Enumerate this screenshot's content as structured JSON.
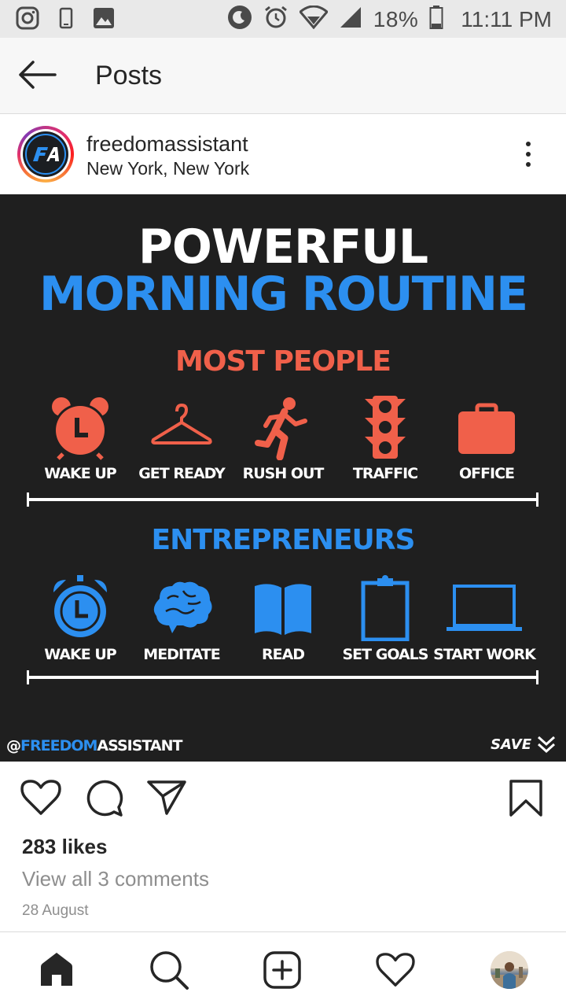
{
  "status_bar": {
    "battery": "18%",
    "time": "11:11 PM",
    "icons": [
      "instagram-icon",
      "phone-icon",
      "image-icon",
      "do-not-disturb-icon",
      "alarm-icon",
      "wifi-icon",
      "signal-icon",
      "battery-icon"
    ]
  },
  "appbar": {
    "title": "Posts"
  },
  "post": {
    "username": "freedomassistant",
    "location": "New York, New York",
    "avatar_text": "FA",
    "image": {
      "title_line1": "POWERFUL",
      "title_line2": "MORNING ROUTINE",
      "section1": "MOST PEOPLE",
      "section1_items": [
        "WAKE UP",
        "GET READY",
        "RUSH OUT",
        "TRAFFIC",
        "OFFICE"
      ],
      "section2": "ENTREPRENEURS",
      "section2_items": [
        "WAKE UP",
        "MEDITATE",
        "READ",
        "SET GOALS",
        "START WORK"
      ],
      "handle_at": "@",
      "handle_blue": "FREEDOM",
      "handle_white": "ASSISTANT",
      "save_label": "SAVE",
      "colors": {
        "background": "#1f1f1f",
        "red": "#f0604a",
        "blue": "#2c8ff0"
      }
    },
    "likes": "283 likes",
    "view_comments": "View all 3 comments",
    "date": "28 August"
  },
  "bottom_nav": {
    "items": [
      "home-icon",
      "search-icon",
      "new-post-icon",
      "activity-heart-icon",
      "profile-avatar"
    ]
  }
}
